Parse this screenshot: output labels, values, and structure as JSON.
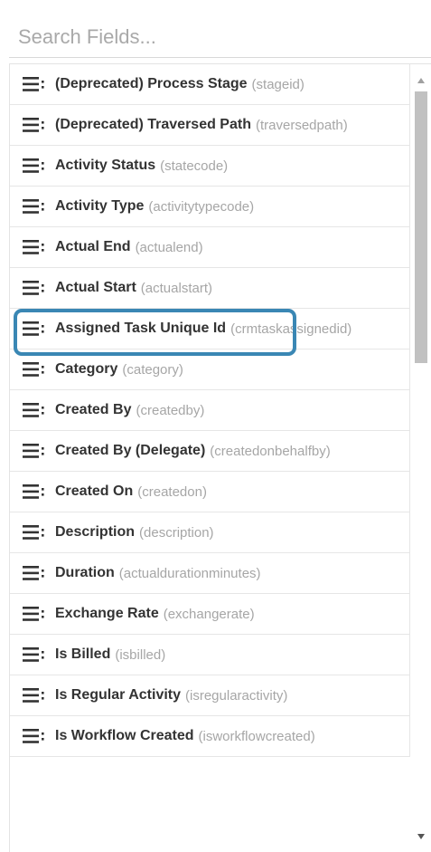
{
  "search": {
    "placeholder": "Search Fields..."
  },
  "fields": [
    {
      "label": "(Deprecated) Process Stage",
      "schema": "(stageid)"
    },
    {
      "label": "(Deprecated) Traversed Path",
      "schema": "(traversedpath)"
    },
    {
      "label": "Activity Status",
      "schema": "(statecode)"
    },
    {
      "label": "Activity Type",
      "schema": "(activitytypecode)"
    },
    {
      "label": "Actual End",
      "schema": "(actualend)"
    },
    {
      "label": "Actual Start",
      "schema": "(actualstart)"
    },
    {
      "label": "Assigned Task Unique Id",
      "schema": "(crmtaskassignedid)"
    },
    {
      "label": "Category",
      "schema": "(category)"
    },
    {
      "label": "Created By",
      "schema": "(createdby)"
    },
    {
      "label": "Created By (Delegate)",
      "schema": "(createdonbehalfby)"
    },
    {
      "label": "Created On",
      "schema": "(createdon)"
    },
    {
      "label": "Description",
      "schema": "(description)"
    },
    {
      "label": "Duration",
      "schema": "(actualdurationminutes)"
    },
    {
      "label": "Exchange Rate",
      "schema": "(exchangerate)"
    },
    {
      "label": "Is Billed",
      "schema": "(isbilled)"
    },
    {
      "label": "Is Regular Activity",
      "schema": "(isregularactivity)"
    },
    {
      "label": "Is Workflow Created",
      "schema": "(isworkflowcreated)"
    }
  ],
  "highlighted_field": "Actual End",
  "colors": {
    "highlight": "#3a87b4",
    "label": "#333333",
    "schema": "#a6a6a6"
  },
  "icons": {
    "row_handle": "drag-handle-icon",
    "scroll_up": "triangle-up-icon",
    "scroll_down": "triangle-down-icon"
  }
}
